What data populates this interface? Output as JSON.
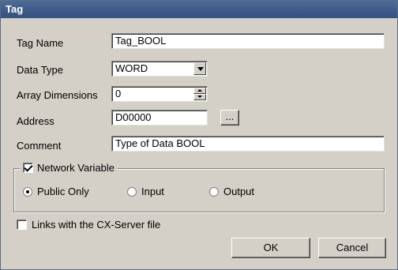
{
  "window": {
    "title": "Tag"
  },
  "labels": {
    "tag_name": "Tag Name",
    "data_type": "Data Type",
    "array_dimensions": "Array Dimensions",
    "address": "Address",
    "comment": "Comment"
  },
  "fields": {
    "tag_name": "Tag_BOOL",
    "data_type": "WORD",
    "array_dimensions": "0",
    "address": "D00000",
    "comment": "Type of Data BOOL"
  },
  "browse_button": "...",
  "network": {
    "label": "Network Variable",
    "checked": true,
    "options": [
      "Public Only",
      "Input",
      "Output"
    ],
    "selected": "Public Only"
  },
  "links": {
    "label": "Links with the CX-Server file",
    "checked": false
  },
  "buttons": {
    "ok": "OK",
    "cancel": "Cancel"
  }
}
